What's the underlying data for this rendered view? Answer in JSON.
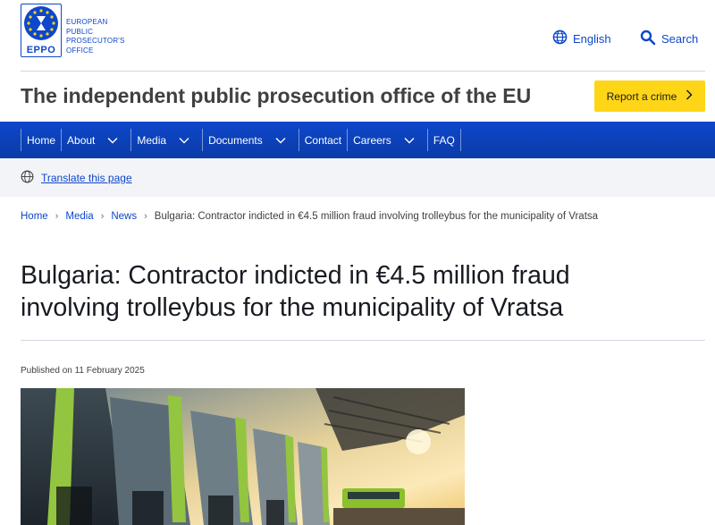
{
  "header": {
    "logo": {
      "abbr": "EPPO",
      "lines": [
        "EUROPEAN",
        "PUBLIC",
        "PROSECUTOR'S",
        "OFFICE"
      ]
    },
    "language_label": "English",
    "search_label": "Search",
    "site_title": "The independent public prosecution office of the EU",
    "report_button": "Report a crime"
  },
  "nav": {
    "items": [
      {
        "label": "Home",
        "dropdown": false
      },
      {
        "label": "About",
        "dropdown": true
      },
      {
        "label": "Media",
        "dropdown": true
      },
      {
        "label": "Documents",
        "dropdown": true
      },
      {
        "label": "Contact",
        "dropdown": false
      },
      {
        "label": "Careers",
        "dropdown": true
      },
      {
        "label": "FAQ",
        "dropdown": false
      }
    ]
  },
  "translate_label": "Translate this page",
  "breadcrumb": {
    "items": [
      "Home",
      "Media",
      "News"
    ],
    "current": "Bulgaria: Contractor indicted in €4.5 million fraud involving trolleybus for the municipality of Vratsa"
  },
  "article": {
    "title_line1": "Bulgaria: Contractor indicted in €4.5 million fraud",
    "title_line2": "involving trolleybus for the municipality of Vratsa",
    "published": "Published on 11 February 2025"
  },
  "colors": {
    "brand_blue": "#0e47cb",
    "accent_yellow": "#ffd617"
  },
  "icons": [
    "globe-icon",
    "search-icon",
    "chevron-right-icon",
    "chevron-down-icon",
    "translate-globe-icon"
  ]
}
